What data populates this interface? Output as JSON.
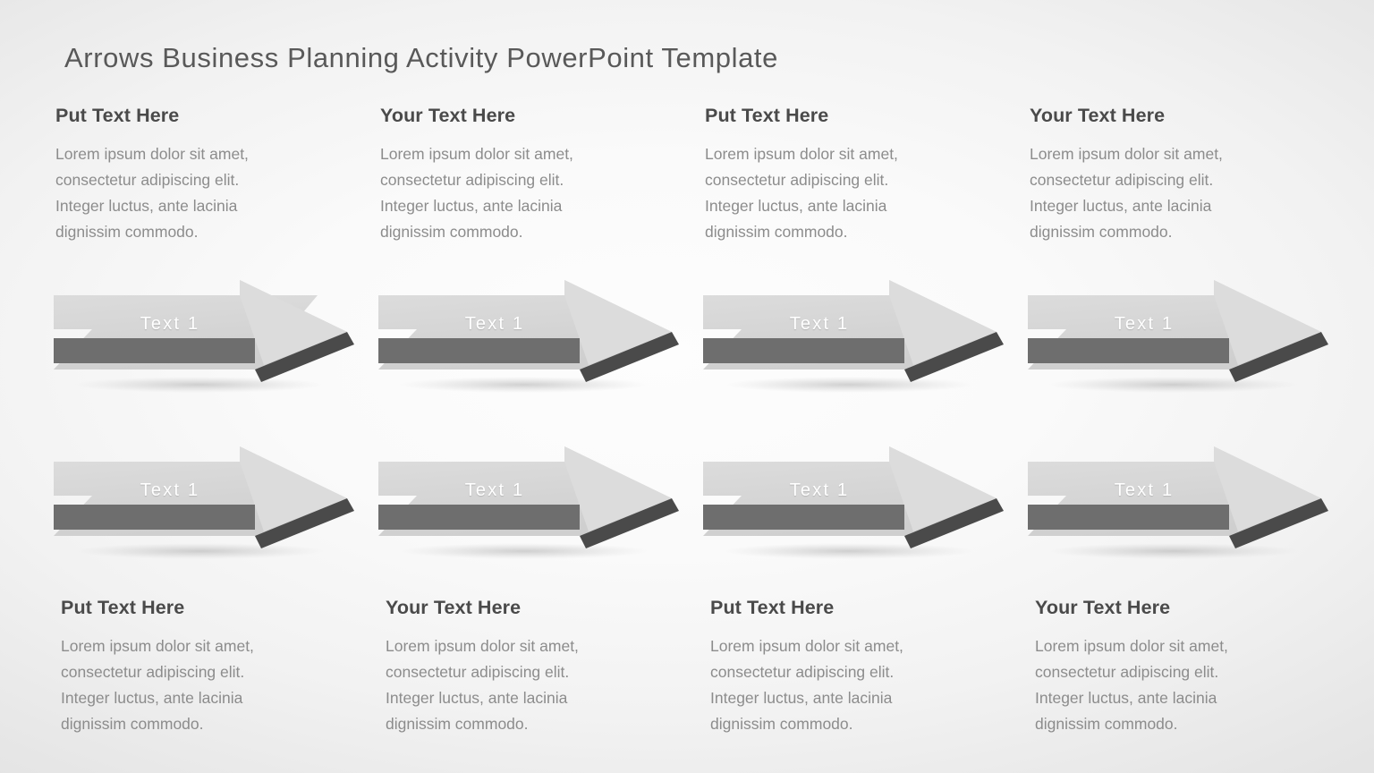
{
  "slide": {
    "title": "Arrows Business Planning Activity PowerPoint Template",
    "background_color": "#f2f2f2",
    "accent_colors": {
      "arrow_face": "#d4d4d4",
      "arrow_face_light": "#e2e2e2",
      "arrow_bevel_dark": "#4a4a4a",
      "arrow_notch_bevel": "#8c8c8c",
      "arrow_bar": "#6e6e6e",
      "heading_text": "#4a4a4a",
      "body_text": "#8c8c8c",
      "title_text": "#595959",
      "arrow_label_text": "#ffffff"
    }
  },
  "body_text": "Lorem ipsum dolor sit amet, consectetur adipiscing elit. Integer luctus, ante lacinia dignissim commodo.",
  "body_lines": [
    "Lorem ipsum dolor sit amet,",
    "consectetur adipiscing elit.",
    "Integer luctus, ante lacinia",
    "dignissim commodo."
  ],
  "rows": [
    {
      "id": "row-1",
      "text_position": "above",
      "columns": [
        {
          "heading": "Put Text Here",
          "body_lines": [
            "Lorem ipsum dolor sit amet,",
            "consectetur adipiscing elit.",
            "Integer luctus, ante lacinia",
            "dignissim commodo."
          ],
          "arrow_label": "Text 1"
        },
        {
          "heading": "Your Text Here",
          "body_lines": [
            "Lorem ipsum dolor sit amet,",
            "consectetur adipiscing elit.",
            "Integer luctus, ante lacinia",
            "dignissim commodo."
          ],
          "arrow_label": "Text 1"
        },
        {
          "heading": "Put Text Here",
          "body_lines": [
            "Lorem ipsum dolor sit amet,",
            "consectetur adipiscing elit.",
            "Integer luctus, ante lacinia",
            "dignissim commodo."
          ],
          "arrow_label": "Text 1"
        },
        {
          "heading": "Your Text Here",
          "body_lines": [
            "Lorem ipsum dolor sit amet,",
            "consectetur adipiscing elit.",
            "Integer luctus, ante lacinia",
            "dignissim commodo."
          ],
          "arrow_label": "Text 1"
        }
      ]
    },
    {
      "id": "row-2",
      "text_position": "below",
      "columns": [
        {
          "heading": "Put Text Here",
          "body_lines": [
            "Lorem ipsum dolor sit amet,",
            "consectetur adipiscing elit.",
            "Integer luctus, ante lacinia",
            "dignissim commodo."
          ],
          "arrow_label": "Text 1"
        },
        {
          "heading": "Your Text Here",
          "body_lines": [
            "Lorem ipsum dolor sit amet,",
            "consectetur adipiscing elit.",
            "Integer luctus, ante lacinia",
            "dignissim commodo."
          ],
          "arrow_label": "Text 1"
        },
        {
          "heading": "Put Text Here",
          "body_lines": [
            "Lorem ipsum dolor sit amet,",
            "consectetur adipiscing elit.",
            "Integer luctus, ante lacinia",
            "dignissim commodo."
          ],
          "arrow_label": "Text 1"
        },
        {
          "heading": "Your Text Here",
          "body_lines": [
            "Lorem ipsum dolor sit amet,",
            "consectetur adipiscing elit.",
            "Integer luctus, ante lacinia",
            "dignissim commodo."
          ],
          "arrow_label": "Text 1"
        }
      ]
    }
  ]
}
